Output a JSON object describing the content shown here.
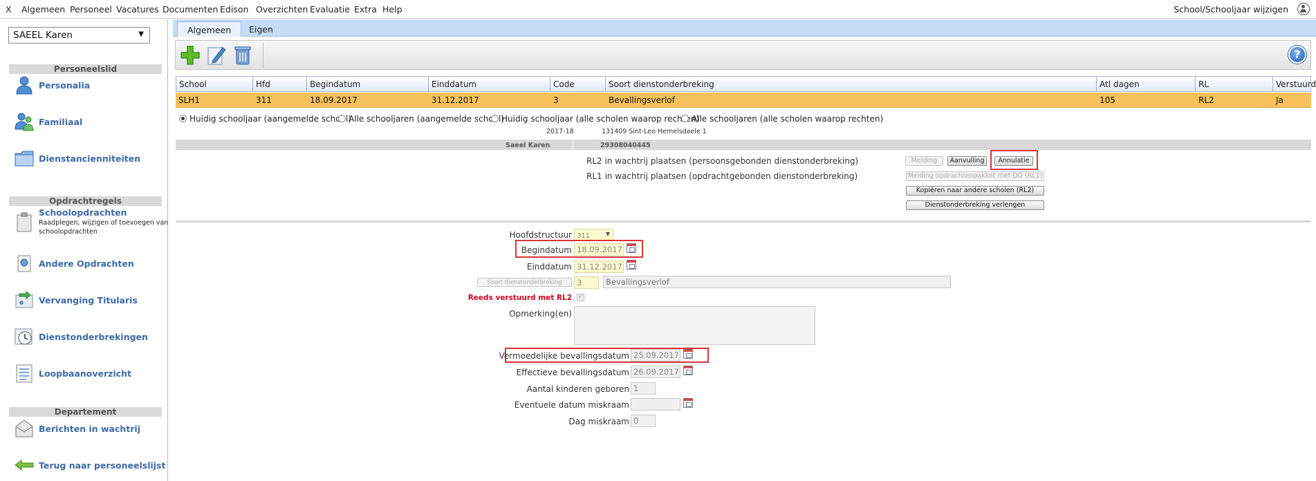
{
  "menu": {
    "close": "X",
    "items": [
      "Algemeen",
      "Personeel",
      "Vacatures",
      "Documenten",
      "Edison",
      "Overzichten",
      "Evaluatie",
      "Extra",
      "Help"
    ],
    "school_switch": "School/Schooljaar wijzigen"
  },
  "sidebar": {
    "person": "SAEEL Karen",
    "section_personeelslid": "Personeelslid",
    "personalia": "Personalia",
    "familiaal": "Familiaal",
    "dienstanciënniteiten": "Dienstancienniteiten",
    "section_opdrachtregels": "Opdrachtregels",
    "schoolopdrachten": "Schoolopdrachten",
    "schoolopdrachten_sub": "Raadplegen, wijzigen of toevoegen van schoolopdrachten",
    "andere_opdrachten": "Andere Opdrachten",
    "vervanging_titularis": "Vervanging Titularis",
    "dienstonderbrekingen": "Dienstonderbrekingen",
    "loopbaanoverzicht": "Loopbaanoverzicht",
    "section_departement": "Departement",
    "berichten": "Berichten in wachtrij",
    "terug": "Terug naar personeelslijst"
  },
  "tabs": [
    "Algemeen",
    "Eigen"
  ],
  "grid": {
    "headers": [
      "School",
      "Hfd",
      "Begindatum",
      "Einddatum",
      "Code",
      "Soort dienstonderbreking",
      "Atl dagen",
      "RL",
      "Verstuurd"
    ],
    "row": [
      "SLH1",
      "311",
      "18.09.2017",
      "31.12.2017",
      "3",
      "Bevallingsverlof",
      "105",
      "RL2",
      "Ja"
    ]
  },
  "filters": {
    "opt1": "Huidig schooljaar (aangemelde school)",
    "opt2": "Alle schooljaren (aangemelde school)",
    "opt3": "Huidig schooljaar (alle scholen waarop rechten)",
    "opt4": "Alle schooljaren (alle scholen waarop rechten)",
    "selected": "opt1"
  },
  "info": {
    "schooljaar": "2017-18",
    "school": "131409 Sint-Leo Hemelsdaele 1",
    "name": "Saeel Karen",
    "stamnummer": "29308040445",
    "rl2_text": "RL2 in wachtrij plaatsen (persoonsgebonden dienstonderbreking)",
    "rl1_text": "RL1 in wachtrij plaatsen (opdrachtgebonden dienstonderbreking)"
  },
  "buttons": {
    "melding": "Melding",
    "aanvulling": "Aanvulling",
    "annulatie": "Annulatie",
    "melding_rl1": "Melding opdrachtenpakket met DO (RL1)",
    "kopieren": "Kopiëren naar andere scholen (RL2)",
    "verlengen": "Dienstonderbreking verlengen"
  },
  "form": {
    "hoofdstructuur_label": "Hoofdstructuur",
    "hoofdstructuur_value": "311",
    "begindatum_label": "Begindatum",
    "begindatum_value": "18.09.2017",
    "einddatum_label": "Einddatum",
    "einddatum_value": "31.12.2017",
    "soort_button": "Soort dienstonderbreking",
    "soort_code": "3",
    "soort_desc": "Bevallingsverlof",
    "verstuurd_label": "Reeds verstuurd met RL2",
    "opmerking_label": "Opmerking(en)",
    "vermoedelijke_label": "Vermoedelijke bevallingsdatum",
    "vermoedelijke_value": "25.09.2017",
    "effectieve_label": "Effectieve bevallingsdatum",
    "effectieve_value": "26.09.2017",
    "kinderen_label": "Aantal kinderen geboren",
    "kinderen_value": "1",
    "miskraam_datum_label": "Eventuele datum miskraam",
    "miskraam_datum_value": "",
    "dag_miskraam_label": "Dag miskraam",
    "dag_miskraam_value": "0"
  },
  "colors": {
    "accent": "#3e6aa6",
    "row_highlight": "#f6c15a",
    "tab_bar": "#c6dbf5",
    "highlight_box": "#d93434"
  }
}
